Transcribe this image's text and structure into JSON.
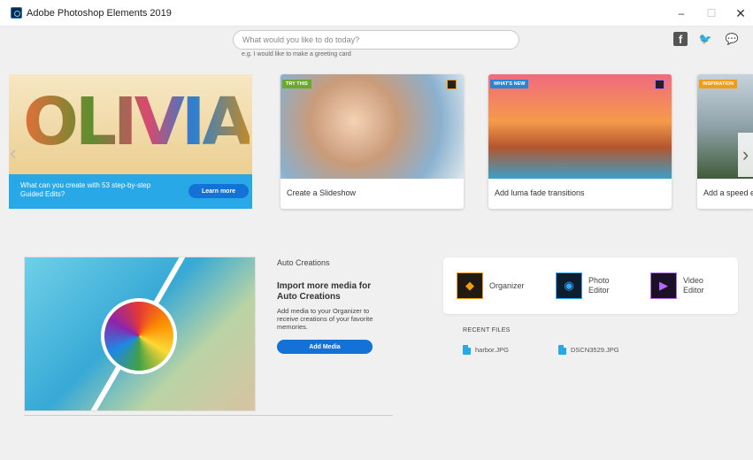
{
  "window": {
    "title": "Adobe Photoshop Elements 2019",
    "minimize": "–",
    "maximize": "☐",
    "close": "✕"
  },
  "search": {
    "placeholder": "What would you like to do today?",
    "hint": "e.g. I would like to make a greeting card"
  },
  "social": {
    "facebook": "f",
    "twitter": "🐦",
    "feedback": "💬"
  },
  "carousel": {
    "hero": {
      "text": "What can you create with 53 step-by-step Guided Edits?",
      "button": "Learn more",
      "art_text": "OLIVIA"
    },
    "cards": [
      {
        "badge": "TRY THIS",
        "badge_color": "#6aa82e",
        "label": "Create a Slideshow"
      },
      {
        "badge": "WHAT'S NEW",
        "badge_color": "#2a86d4",
        "label": "Add luma fade transitions"
      },
      {
        "badge": "INSPIRATION",
        "badge_color": "#f39c12",
        "label": "Add a speed e"
      }
    ],
    "prev": "‹",
    "next": "›"
  },
  "auto_creations": {
    "label": "Auto Creations",
    "title": "Import more media for Auto Creations",
    "description": "Add media to your Organizer to receive creations of your favorite memories.",
    "button": "Add Media"
  },
  "launcher": {
    "apps": [
      {
        "name": "Organizer",
        "icon": "organizer-icon",
        "color": "#f39c12"
      },
      {
        "name": "Photo Editor",
        "icon": "photo-editor-icon",
        "color": "#31a8ff"
      },
      {
        "name": "Video Editor",
        "icon": "video-editor-icon",
        "color": "#b26bff"
      }
    ]
  },
  "recent": {
    "heading": "RECENT FILES",
    "files": [
      "harbor.JPG",
      "DSCN3529.JPG"
    ]
  }
}
